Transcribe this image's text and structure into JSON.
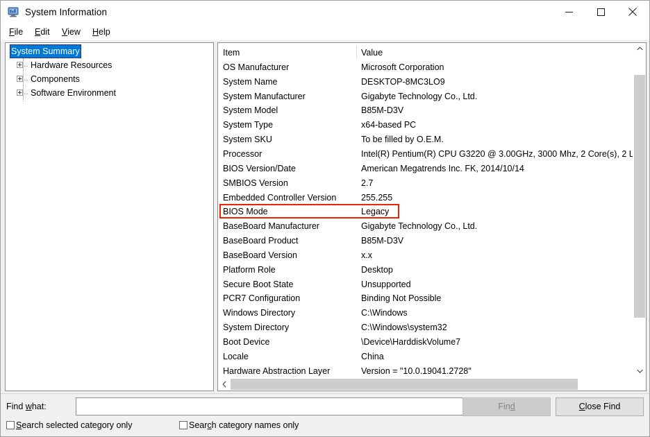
{
  "window": {
    "title": "System Information",
    "icon": "system-information-icon",
    "controls": {
      "minimize": "minimize-icon",
      "maximize": "maximize-icon",
      "close": "close-icon"
    }
  },
  "menubar": {
    "items": [
      {
        "label": "File",
        "accel": "F"
      },
      {
        "label": "Edit",
        "accel": "E"
      },
      {
        "label": "View",
        "accel": "V"
      },
      {
        "label": "Help",
        "accel": "H"
      }
    ]
  },
  "tree": {
    "root": "System Summary",
    "children": [
      "Hardware Resources",
      "Components",
      "Software Environment"
    ],
    "selected": "System Summary"
  },
  "list": {
    "columns": [
      "Item",
      "Value"
    ],
    "rows": [
      {
        "item": "OS Manufacturer",
        "value": "Microsoft Corporation"
      },
      {
        "item": "System Name",
        "value": "DESKTOP-8MC3LO9"
      },
      {
        "item": "System Manufacturer",
        "value": "Gigabyte Technology Co., Ltd."
      },
      {
        "item": "System Model",
        "value": "B85M-D3V"
      },
      {
        "item": "System Type",
        "value": "x64-based PC"
      },
      {
        "item": "System SKU",
        "value": "To be filled by O.E.M."
      },
      {
        "item": "Processor",
        "value": "Intel(R) Pentium(R) CPU G3220 @ 3.00GHz, 3000 Mhz, 2 Core(s), 2 L"
      },
      {
        "item": "BIOS Version/Date",
        "value": "American Megatrends Inc. FK, 2014/10/14"
      },
      {
        "item": "SMBIOS Version",
        "value": "2.7"
      },
      {
        "item": "Embedded Controller Version",
        "value": "255.255"
      },
      {
        "item": "BIOS Mode",
        "value": "Legacy"
      },
      {
        "item": "BaseBoard Manufacturer",
        "value": "Gigabyte Technology Co., Ltd."
      },
      {
        "item": "BaseBoard Product",
        "value": "B85M-D3V"
      },
      {
        "item": "BaseBoard Version",
        "value": "x.x"
      },
      {
        "item": "Platform Role",
        "value": "Desktop"
      },
      {
        "item": "Secure Boot State",
        "value": "Unsupported"
      },
      {
        "item": "PCR7 Configuration",
        "value": "Binding Not Possible"
      },
      {
        "item": "Windows Directory",
        "value": "C:\\Windows"
      },
      {
        "item": "System Directory",
        "value": "C:\\Windows\\system32"
      },
      {
        "item": "Boot Device",
        "value": "\\Device\\HarddiskVolume7"
      },
      {
        "item": "Locale",
        "value": "China"
      },
      {
        "item": "Hardware Abstraction Layer",
        "value": "Version = \"10.0.19041.2728\""
      }
    ],
    "highlight": {
      "row_item": "BIOS Mode",
      "color": "#ee2200"
    }
  },
  "findbar": {
    "label": "Find what:",
    "accel": "w",
    "input_value": "",
    "input_placeholder": "",
    "find_button": "Find",
    "find_button_accel": "d",
    "find_button_disabled": true,
    "close_find_button": "Close Find",
    "close_find_accel": "C",
    "checkbox1": "Search selected category only",
    "checkbox1_accel": "S",
    "checkbox1_checked": false,
    "checkbox2": "Search category names only",
    "checkbox2_accel": "c",
    "checkbox2_checked": false
  }
}
